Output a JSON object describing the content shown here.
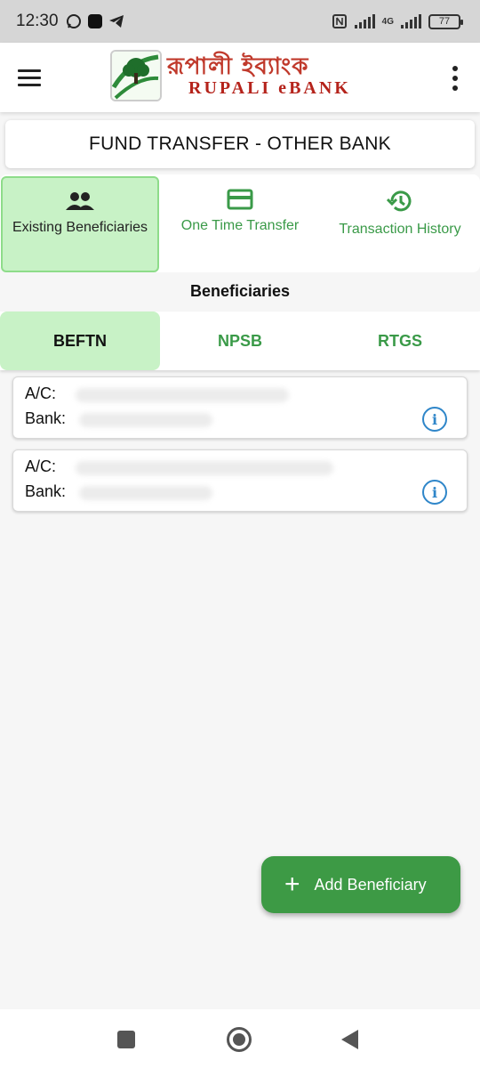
{
  "status": {
    "time": "12:30",
    "network": "4G",
    "battery": "77",
    "icons": [
      "whatsapp-icon",
      "app-icon",
      "telegram-icon",
      "nfc-icon",
      "signal-icon",
      "signal-4g-icon",
      "battery-icon"
    ]
  },
  "header": {
    "brand_bengali": "রূপালী ইব্যাংক",
    "brand_english": "RUPALI eBANK",
    "logo_text": "RUPALI eBANK",
    "menu_icon": "hamburger-menu-icon",
    "more_icon": "more-vert-icon"
  },
  "page": {
    "title": "FUND TRANSFER - OTHER BANK"
  },
  "mode_tabs": [
    {
      "label": "Existing Beneficiaries",
      "icon": "people-icon",
      "active": true
    },
    {
      "label": "One Time Transfer",
      "icon": "card-icon",
      "active": false
    },
    {
      "label": "Transaction History",
      "icon": "history-icon",
      "active": false
    }
  ],
  "beneficiaries": {
    "section_title": "Beneficiaries",
    "tabs": [
      {
        "label": "BEFTN",
        "active": true
      },
      {
        "label": "NPSB",
        "active": false
      },
      {
        "label": "RTGS",
        "active": false
      }
    ],
    "items": [
      {
        "account_label": "A/C:",
        "bank_label": "Bank:"
      },
      {
        "account_label": "A/C:",
        "bank_label": "Bank:"
      }
    ]
  },
  "actions": {
    "add_beneficiary": "Add Beneficiary"
  },
  "colors": {
    "accent_green": "#3d9a45",
    "active_tab_bg": "#c8f2c6",
    "brand_red": "#c0392b",
    "info_blue": "#2f86c9"
  }
}
